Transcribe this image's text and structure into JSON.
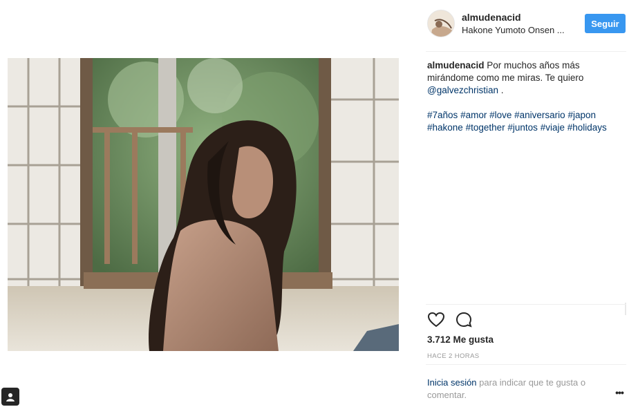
{
  "post": {
    "username": "almudenacid",
    "location": "Hakone Yumoto Onsen ...",
    "follow_label": "Seguir",
    "caption_user": "almudenacid",
    "caption_text": "Por muchos años más mirándome como me miras. Te quiero",
    "mention": "@galvezchristian",
    "caption_end": " .",
    "hashtags": [
      "#7años",
      "#amor",
      "#love",
      "#aniversario",
      "#japon",
      "#hakone",
      "#together",
      "#juntos",
      "#viaje",
      "#holidays"
    ],
    "likes": "3.712 Me gusta",
    "time": "HACE 2 HORAS",
    "login_link": "Inicia sesión",
    "login_rest": " para indicar que te gusta o comentar.",
    "more_label": "•••"
  },
  "icons": {
    "like": "heart-icon",
    "comment": "comment-icon",
    "more": "more-options-icon",
    "corner": "profile-icon"
  },
  "colors": {
    "accent": "#3897f0",
    "link": "#003569",
    "muted": "#999999",
    "text": "#262626"
  }
}
